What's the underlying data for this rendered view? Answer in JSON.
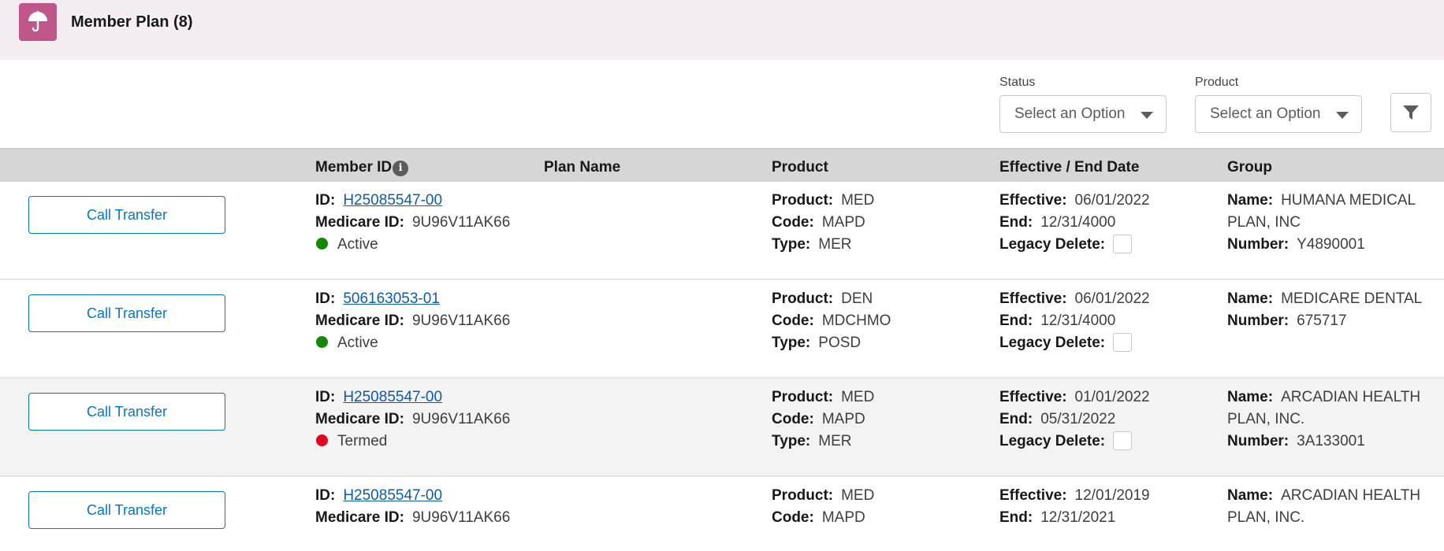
{
  "header": {
    "title": "Member Plan (8)",
    "icon": "umbrella-icon",
    "icon_color": "#c0578a"
  },
  "filters": {
    "status_label": "Status",
    "status_value": "Select an Option",
    "product_label": "Product",
    "product_value": "Select an Option"
  },
  "columns": {
    "member_id": "Member ID",
    "plan_name": "Plan Name",
    "product": "Product",
    "dates": "Effective / End Date",
    "group": "Group"
  },
  "labels": {
    "call_transfer": "Call Transfer",
    "id": "ID:",
    "medicare_id": "Medicare ID:",
    "product": "Product:",
    "code": "Code:",
    "type": "Type:",
    "effective": "Effective:",
    "end": "End:",
    "legacy_delete": "Legacy Delete:",
    "name": "Name:",
    "number": "Number:"
  },
  "rows": [
    {
      "id": "H25085547-00",
      "medicare_id": "9U96V11AK66",
      "status": "Active",
      "status_color": "#118a00",
      "product": "MED",
      "code": "MAPD",
      "type": "MER",
      "effective": "06/01/2022",
      "end": "12/31/4000",
      "group_name": "HUMANA MEDICAL PLAN, INC",
      "group_number": "Y4890001"
    },
    {
      "id": "506163053-01",
      "medicare_id": "9U96V11AK66",
      "status": "Active",
      "status_color": "#118a00",
      "product": "DEN",
      "code": "MDCHMO",
      "type": "POSD",
      "effective": "06/01/2022",
      "end": "12/31/4000",
      "group_name": "MEDICARE DENTAL",
      "group_number": "675717"
    },
    {
      "id": "H25085547-00",
      "medicare_id": "9U96V11AK66",
      "status": "Termed",
      "status_color": "#ea001e",
      "product": "MED",
      "code": "MAPD",
      "type": "MER",
      "effective": "01/01/2022",
      "end": "05/31/2022",
      "group_name": "ARCADIAN HEALTH PLAN, INC.",
      "group_number": "3A133001"
    },
    {
      "id": "H25085547-00",
      "medicare_id": "9U96V11AK66",
      "product": "MED",
      "code": "MAPD",
      "effective": "12/01/2019",
      "end": "12/31/2021",
      "group_name": "ARCADIAN HEALTH PLAN, INC."
    }
  ]
}
